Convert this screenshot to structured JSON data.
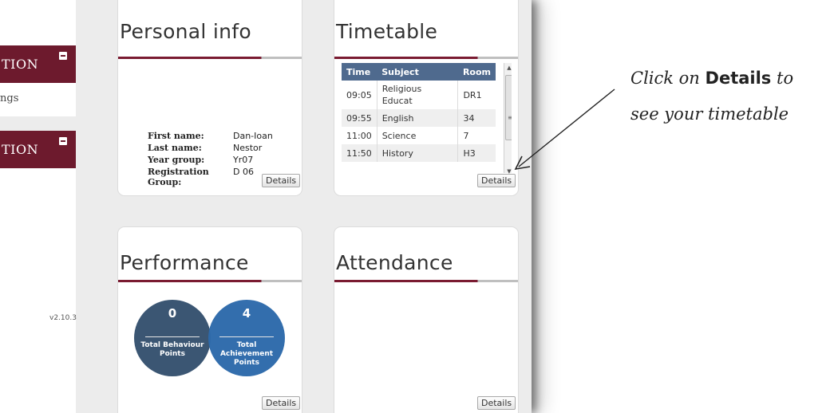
{
  "sidebar": {
    "section1": "TION",
    "section1_sub": "ngs",
    "section2": "TION",
    "version": "v2.10.3"
  },
  "personal_info": {
    "title": "Personal info",
    "fields": [
      {
        "label": "First name:",
        "value": "Dan-Ioan"
      },
      {
        "label": "Last name:",
        "value": "Nestor"
      },
      {
        "label": "Year group:",
        "value": "Yr07"
      },
      {
        "label": "Registration Group:",
        "value": "D 06"
      }
    ],
    "details_label": "Details"
  },
  "timetable": {
    "title": "Timetable",
    "headers": [
      "Time",
      "Subject",
      "Room"
    ],
    "rows": [
      {
        "time": "09:05",
        "subject": "Religious Educat",
        "room": "DR1"
      },
      {
        "time": "09:55",
        "subject": "English",
        "room": "34"
      },
      {
        "time": "11:00",
        "subject": "Science",
        "room": "7"
      },
      {
        "time": "11:50",
        "subject": "History",
        "room": "H3"
      }
    ],
    "details_label": "Details"
  },
  "performance": {
    "title": "Performance",
    "behaviour": {
      "value": "0",
      "label": "Total Behaviour Points",
      "color": "#3b5673"
    },
    "achievement": {
      "value": "4",
      "label": "Total Achievement Points",
      "color": "#2d6aab"
    },
    "details_label": "Details"
  },
  "attendance": {
    "title": "Attendance",
    "details_label": "Details"
  },
  "annotation": {
    "line1_prefix": "Click on",
    "line1_bold": "Details",
    "line1_suffix": "to",
    "line2": "see your timetable"
  }
}
